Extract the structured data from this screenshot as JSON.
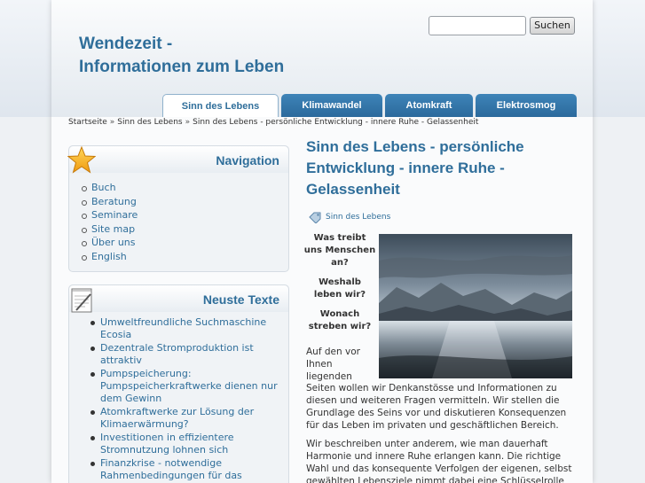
{
  "site": {
    "title_line1": "Wendezeit -",
    "title_line2": "Informationen zum Leben"
  },
  "search": {
    "placeholder": "",
    "value": "",
    "button_label": "Suchen"
  },
  "tabs": [
    {
      "label": "Sinn des Lebens",
      "active": true
    },
    {
      "label": "Klimawandel",
      "active": false
    },
    {
      "label": "Atomkraft",
      "active": false
    },
    {
      "label": "Elektrosmog",
      "active": false
    }
  ],
  "breadcrumb": {
    "items": [
      "Startseite",
      "Sinn des Lebens",
      "Sinn des Lebens - persönliche Entwicklung - innere Ruhe - Gelassenheit"
    ],
    "separator": "»"
  },
  "navigation": {
    "title": "Navigation",
    "icon": "star-icon",
    "items": [
      "Buch",
      "Beratung",
      "Seminare",
      "Site map",
      "Über uns",
      "English"
    ]
  },
  "news": {
    "title": "Neuste Texte",
    "icon": "notepad-icon",
    "items": [
      "Umweltfreundliche Suchmaschine Ecosia",
      "Dezentrale Stromproduktion ist attraktiv",
      "Pumpspeicherung: Pumpspeicherkraftwerke dienen nur dem Gewinn",
      "Atomkraftwerke zur Lösung der Klimaerwärmung?",
      "Investitionen in effizientere Stromnutzung lohnen sich",
      "Finanzkrise - notwendige Rahmenbedingungen für das Finanzwesen"
    ]
  },
  "article": {
    "title": "Sinn des Lebens - persönliche Entwicklung - innere Ruhe - Gelassenheit",
    "tag": "Sinn des Lebens",
    "questions": [
      "Was treibt uns Menschen an?",
      "Weshalb leben wir?",
      "Wonach streben wir?"
    ],
    "intro_start": "Auf den vor Ihnen liegenden",
    "intro_rest": "Seiten wollen wir Denkanstösse und Informationen zu diesen und weiteren Fragen vermitteln. Wir stellen die Grundlage des Seins vor und diskutieren Konsequenzen für das Leben im privaten und geschäftlichen Bereich.",
    "paragraph2": "Wir beschreiben unter anderem, wie man dauerhaft Harmonie und innere Ruhe erlangen kann. Die richtige Wahl und das konsequente Verfolgen der eigenen, selbst gewählten Lebensziele nimmt dabei eine Schlüsselrolle ein - damit man"
  },
  "colors": {
    "brand": "#2f6e9a",
    "tab_bg": "#2b6a9c",
    "box_bg": "#f0f3f6"
  }
}
